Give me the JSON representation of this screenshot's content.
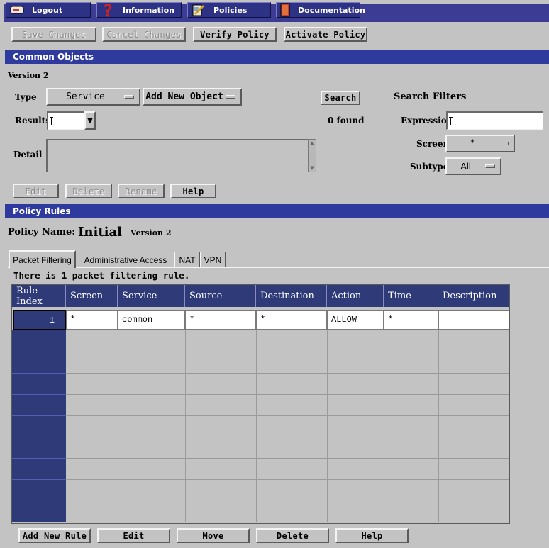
{
  "nav": {
    "items": [
      {
        "label": "Logout",
        "icon": "logout-icon"
      },
      {
        "label": "Information",
        "icon": "question-mark-icon"
      },
      {
        "label": "Policies",
        "icon": "policies-icon"
      },
      {
        "label": "Documentation",
        "icon": "book-icon"
      }
    ]
  },
  "toolbar": {
    "save": "Save Changes",
    "cancel": "Cancel Changes",
    "verify": "Verify Policy",
    "activate": "Activate Policy"
  },
  "common_objects": {
    "title": "Common Objects",
    "version": "Version 2",
    "type_label": "Type",
    "type_value": "Service",
    "add_new_object": "Add New Object",
    "search_button": "Search",
    "search_filters_label": "Search Filters",
    "results_label": "Results",
    "found_text": "0 found",
    "expression_label": "Expression",
    "screen_label": "Screen",
    "screen_value": "*",
    "subtype_label": "Subtype",
    "subtype_value": "All",
    "detail_label": "Detail",
    "buttons": {
      "edit": "Edit",
      "delete": "Delete",
      "rename": "Rename",
      "help": "Help"
    }
  },
  "policy_rules": {
    "title": "Policy Rules",
    "policy_name_label": "Policy Name:",
    "policy_name": "Initial",
    "version": "Version 2",
    "tabs": [
      "Packet Filtering",
      "Administrative Access",
      "NAT",
      "VPN"
    ],
    "rule_count_text": "There is 1 packet filtering rule.",
    "columns": [
      "Rule Index",
      "Screen",
      "Service",
      "Source",
      "Destination",
      "Action",
      "Time",
      "Description"
    ],
    "rows": [
      {
        "index": "1",
        "screen": "*",
        "service": "common",
        "source": "*",
        "destination": "*",
        "action": "ALLOW",
        "time": "*",
        "description": ""
      }
    ],
    "buttons": {
      "add": "Add New Rule",
      "edit": "Edit",
      "move": "Move",
      "delete": "Delete",
      "help": "Help"
    }
  },
  "colors": {
    "nav_bg": "#3c3c94",
    "section_bar": "#2f3a9e",
    "table_header": "#2f3a78",
    "panel_bg": "#c3c3c3"
  }
}
